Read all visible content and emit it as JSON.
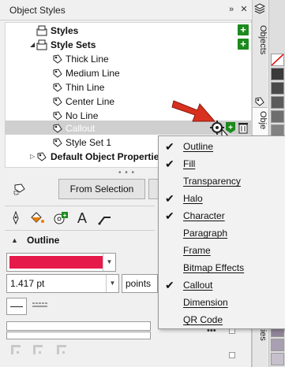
{
  "window": {
    "title": "Object Styles"
  },
  "tree": {
    "styles": "Styles",
    "style_sets": "Style Sets",
    "items": [
      "Thick Line",
      "Medium Line",
      "Thin Line",
      "Center Line",
      "No Line",
      "Callout",
      "Style Set 1"
    ],
    "selected": "Callout",
    "default_props": "Default Object Properties"
  },
  "tabs": {
    "objects": "Objects",
    "obj_partial": "Obje",
    "properties_partial": "rties"
  },
  "buttons": {
    "from_selection": "From Selection"
  },
  "outline": {
    "title": "Outline",
    "color": "#e6194b",
    "width_value": "1.417 pt",
    "units": "points",
    "more": "•••"
  },
  "menu": {
    "items": [
      {
        "label": "Outline",
        "checked": true
      },
      {
        "label": "Fill",
        "checked": true
      },
      {
        "label": "Transparency",
        "checked": false
      },
      {
        "label": "Halo",
        "checked": true
      },
      {
        "label": "Character",
        "checked": true
      },
      {
        "label": "Paragraph",
        "checked": false
      },
      {
        "label": "Frame",
        "checked": false
      },
      {
        "label": "Bitmap Effects",
        "checked": false
      },
      {
        "label": "Callout",
        "checked": true
      },
      {
        "label": "Dimension",
        "checked": false
      },
      {
        "label": "QR Code",
        "checked": false
      }
    ],
    "check_glyph": "✔"
  },
  "colors": {
    "accent_arrow": "#d8311f",
    "add_green": "#1c8a1c"
  }
}
